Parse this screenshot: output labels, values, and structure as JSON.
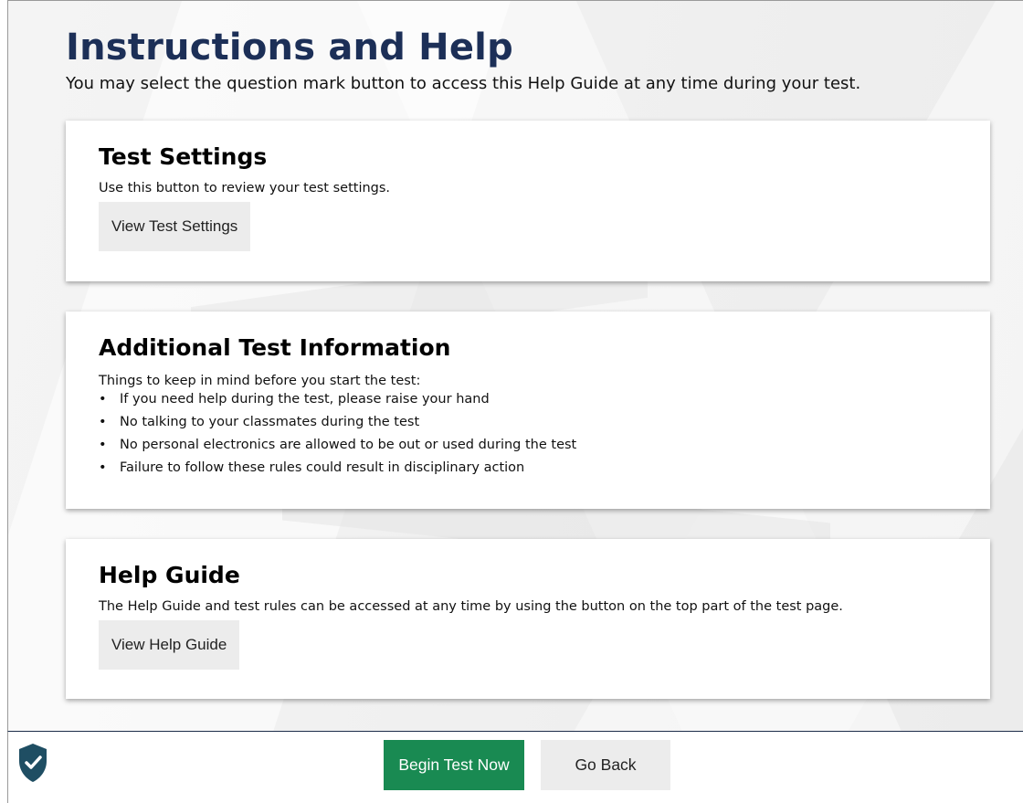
{
  "header": {
    "title": "Instructions and Help",
    "subtitle": "You may select the question mark button to access this Help Guide at any time during your test."
  },
  "cards": {
    "test_settings": {
      "title": "Test Settings",
      "text": "Use this button to review your test settings.",
      "button_label": "View Test Settings"
    },
    "additional_info": {
      "title": "Additional Test Information",
      "text": "Things to keep in mind before you start the test:",
      "bullets": [
        "If you need help during the test, please raise your hand",
        "No talking to your classmates during the test",
        "No personal electronics are allowed to be out or used during the test",
        "Failure to follow these rules could result in disciplinary action"
      ]
    },
    "help_guide": {
      "title": "Help Guide",
      "text": "The Help Guide and test rules can be accessed at any time by using the button on the top part of the test page.",
      "button_label": "View Help Guide"
    }
  },
  "footer": {
    "logo_icon": "shield-check-icon",
    "begin_label": "Begin Test Now",
    "back_label": "Go Back"
  },
  "colors": {
    "title": "#1c2f57",
    "begin_button": "#198a52",
    "shield": "#1f4e63"
  }
}
